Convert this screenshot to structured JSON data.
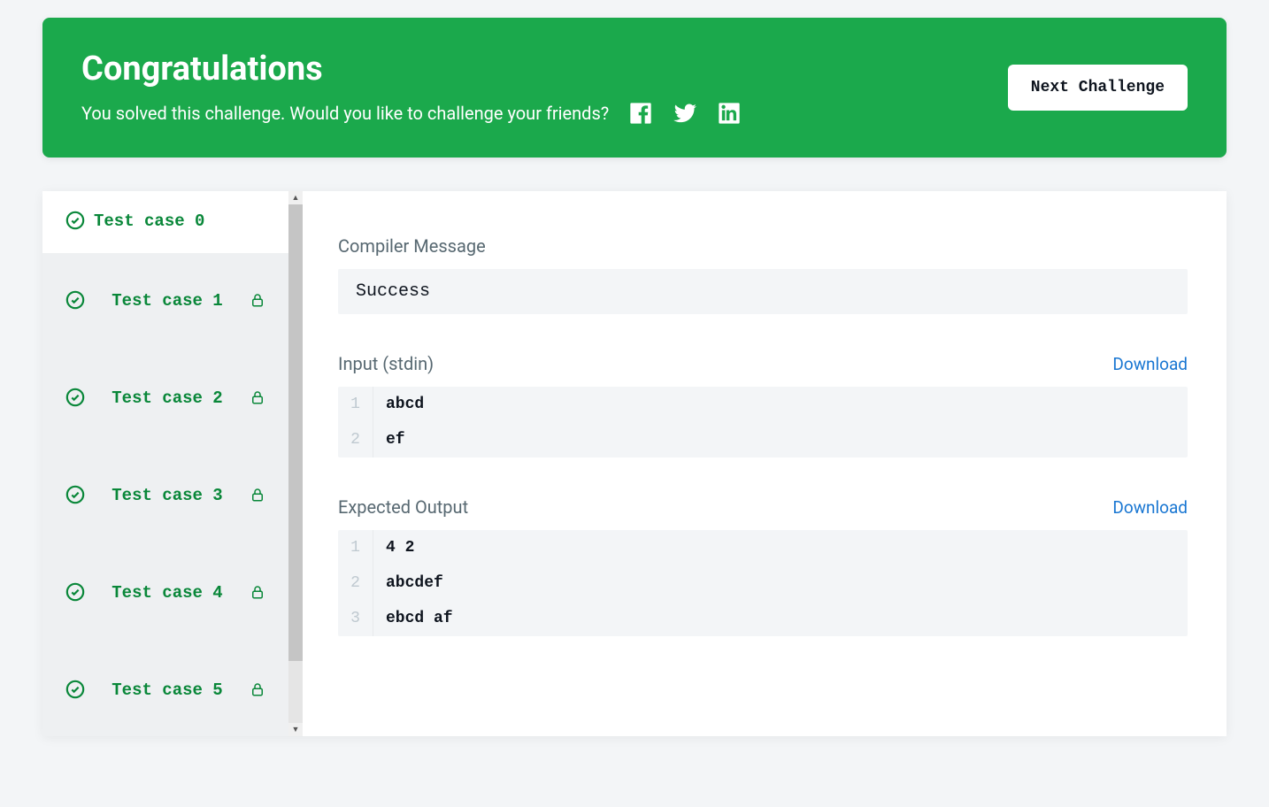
{
  "banner": {
    "title": "Congratulations",
    "subtitle": "You solved this challenge. Would you like to challenge your friends?",
    "next_label": "Next Challenge"
  },
  "sidebar": {
    "items": [
      {
        "label": "Test case 0",
        "locked": false,
        "active": true
      },
      {
        "label": "Test case 1",
        "locked": true,
        "active": false
      },
      {
        "label": "Test case 2",
        "locked": true,
        "active": false
      },
      {
        "label": "Test case 3",
        "locked": true,
        "active": false
      },
      {
        "label": "Test case 4",
        "locked": true,
        "active": false
      },
      {
        "label": "Test case 5",
        "locked": true,
        "active": false
      }
    ]
  },
  "detail": {
    "compiler_title": "Compiler Message",
    "compiler_msg": "Success",
    "input_title": "Input (stdin)",
    "output_title": "Expected Output",
    "download_label": "Download",
    "input_lines": [
      "abcd",
      "ef"
    ],
    "output_lines": [
      "4 2",
      "abcdef",
      "ebcd af"
    ]
  }
}
